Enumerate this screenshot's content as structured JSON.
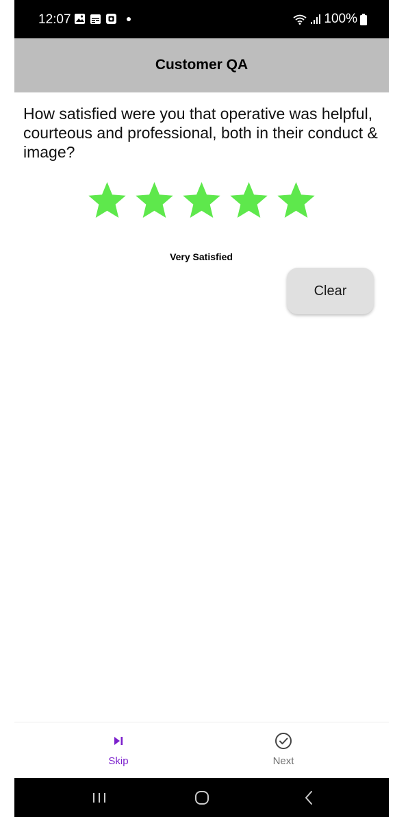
{
  "status_bar": {
    "time": "12:07",
    "battery_text": "100%",
    "icons": [
      "gallery-icon",
      "calendar-icon",
      "screen-record-icon",
      "notification-dot-icon",
      "wifi-icon",
      "signal-icon",
      "battery-icon"
    ]
  },
  "header": {
    "title": "Customer QA"
  },
  "question": {
    "text": "How satisfied were you that operative was helpful, courteous and professional, both in their conduct & image?"
  },
  "rating": {
    "value": 5,
    "max": 5,
    "label": "Very Satisfied",
    "star_color": "#5ee84c"
  },
  "clear_button": {
    "label": "Clear"
  },
  "bottom_nav": {
    "skip_label": "Skip",
    "next_label": "Next",
    "skip_color": "#7b1fcc",
    "next_color": "#6f6f6f"
  },
  "system_nav": {
    "buttons": [
      "recents-icon",
      "home-icon",
      "back-icon"
    ]
  }
}
